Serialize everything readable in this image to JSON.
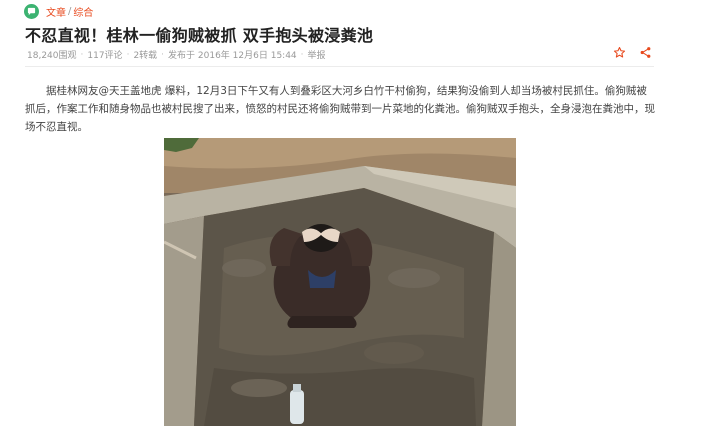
{
  "breadcrumb": {
    "section": "文章",
    "category": "综合",
    "separator": "/"
  },
  "article": {
    "title": "不忍直视！桂林一偷狗贼被抓 双手抱头被浸粪池",
    "views": "18,240围观",
    "comments": "117评论",
    "shares": "2转载",
    "published": "发布于 2016年 12月6日 15:44",
    "report": "举报",
    "body": "据桂林网友@天王盖地虎 爆料，12月3日下午又有人到叠彩区大河乡白竹干村偷狗，结果狗没偷到人却当场被村民抓住。偷狗贼被抓后，作案工作和随身物品也被村民搜了出来，愤怒的村民还将偷狗贼带到一片菜地的化粪池。偷狗贼双手抱头，全身浸泡在粪池中，现场不忍直视。"
  },
  "icons": {
    "section_icon": "chat-bubble-icon",
    "favorite": "star-outline-icon",
    "share": "share-icon"
  },
  "colors": {
    "accent": "#e8491d",
    "section_icon_bg": "#3cb371",
    "meta_text": "#999999",
    "title_text": "#222222"
  }
}
